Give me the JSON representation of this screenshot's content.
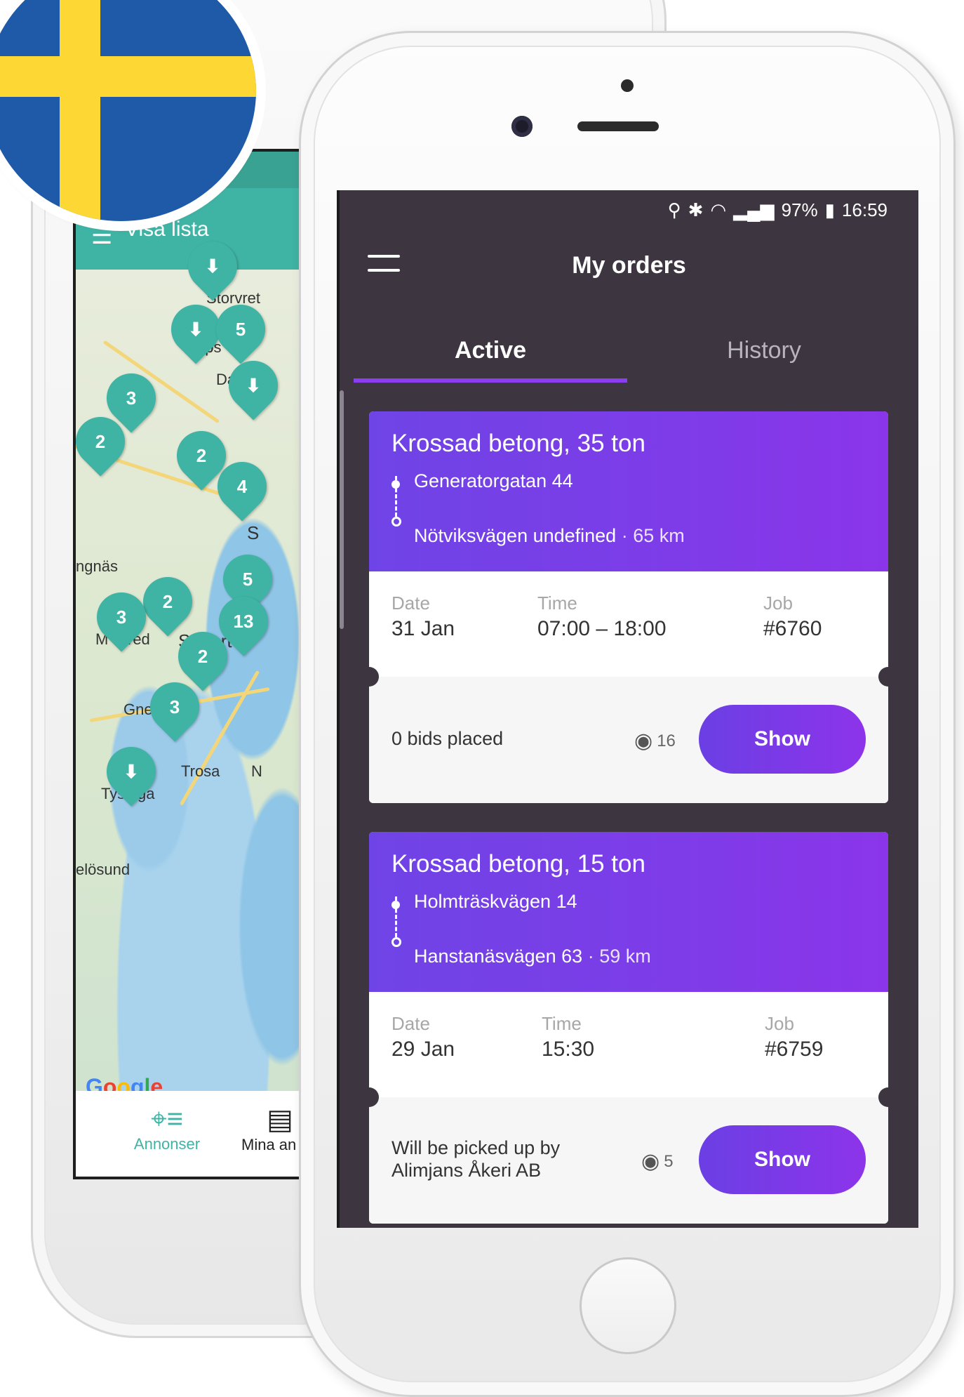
{
  "back_app": {
    "header_label": "Visa lista",
    "map_labels": [
      "Storvret",
      "pps",
      "Da",
      "g",
      "ngnäs",
      "red",
      "Södert",
      "Gnes",
      "Trosa",
      "Tys",
      "ga",
      "elösund",
      "S",
      "M",
      "N"
    ],
    "pins": [
      "3",
      "5",
      "2",
      "2",
      "4",
      "5",
      "2",
      "3",
      "13",
      "2",
      "3"
    ],
    "attribution": "Google",
    "nav": [
      {
        "label": "Annonser",
        "icon": "map-pin-list-icon",
        "color": "#3fb3a4"
      },
      {
        "label": "Mina an",
        "icon": "document-icon"
      }
    ]
  },
  "flag": {
    "country": "Sweden",
    "blue": "#1e5aa8",
    "yellow": "#fdd835"
  },
  "status_bar": {
    "battery": "97%",
    "time": "16:59"
  },
  "app": {
    "title": "My orders",
    "tabs": [
      {
        "label": "Active",
        "active": true
      },
      {
        "label": "History",
        "active": false
      }
    ],
    "accent": "#8b3df0"
  },
  "orders": [
    {
      "title": "Krossad betong, 35 ton",
      "from": "Generatorgatan 44",
      "to": "Nötviksvägen undefined",
      "distance": "65 km",
      "date_label": "Date",
      "date": "31 Jan",
      "time_label": "Time",
      "time": "07:00 – 18:00",
      "job_label": "Job",
      "job": "#6760",
      "status_line1": "0 bids placed",
      "status_line2": "",
      "views": "16",
      "button": "Show"
    },
    {
      "title": "Krossad betong, 15 ton",
      "from": "Holmträskvägen 14",
      "to": "Hanstanäsvägen 63",
      "distance": "59 km",
      "date_label": "Date",
      "date": "29 Jan",
      "time_label": "Time",
      "time": "15:30",
      "job_label": "Job",
      "job": "#6759",
      "status_line1": "Will be picked up by",
      "status_line2": "Alimjans Åkeri AB",
      "views": "5",
      "button": "Show"
    }
  ]
}
